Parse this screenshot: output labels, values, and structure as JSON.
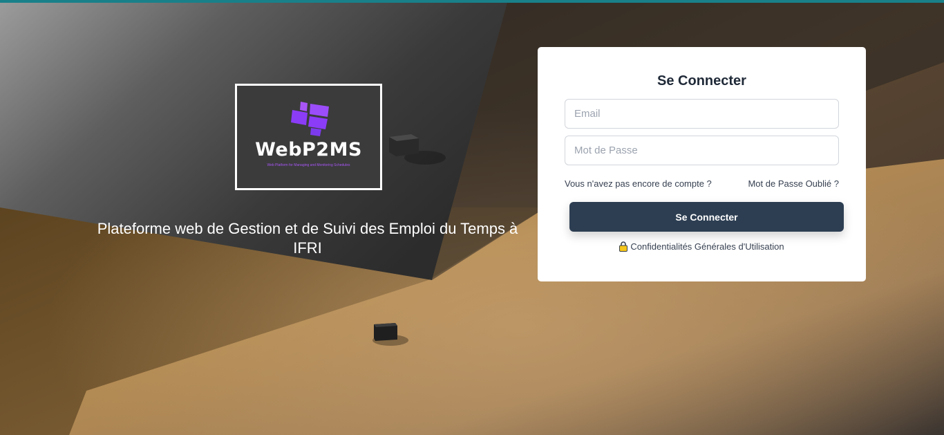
{
  "branding": {
    "logo_name": "WebP2MS",
    "logo_tagline": "Web Platform for Managing and Monitoring Schedules",
    "headline": "Plateforme web de Gestion et de Suivi des Emploi du Temps à IFRI"
  },
  "login": {
    "title": "Se Connecter",
    "email_placeholder": "Email",
    "password_placeholder": "Mot de Passe",
    "register_link": "Vous n'avez pas encore de compte ?",
    "forgot_link": "Mot de Passe Oublié ?",
    "submit_label": "Se Connecter",
    "terms_label": "Confidentialités Générales d'Utilisation",
    "terms_icon": "lock-icon"
  },
  "colors": {
    "accent_strip": "#19808a",
    "button": "#2d3e52",
    "logo_purple": "#8b3cf7"
  }
}
